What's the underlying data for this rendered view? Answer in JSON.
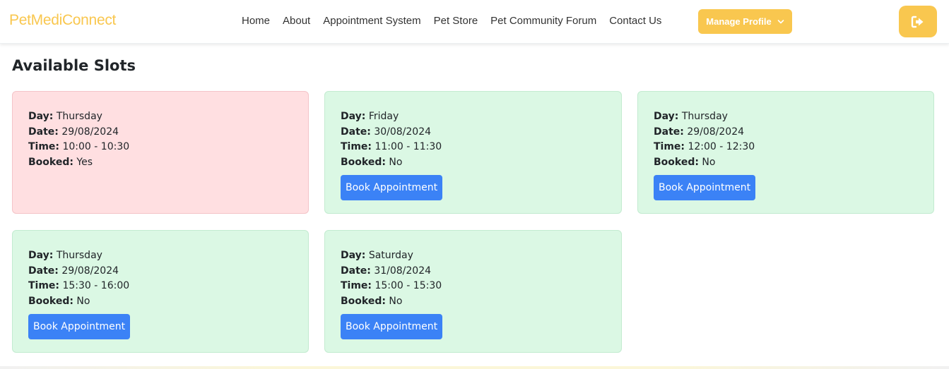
{
  "brand": "PetMediConnect",
  "nav": {
    "links": [
      "Home",
      "About",
      "Appointment System",
      "Pet Store",
      "Pet Community Forum",
      "Contact Us"
    ],
    "manage_profile": "Manage Profile",
    "logout_icon": "sign-out-icon"
  },
  "page": {
    "title": "Available Slots"
  },
  "labels": {
    "day": "Day:",
    "date": "Date:",
    "time": "Time:",
    "booked": "Booked:"
  },
  "slots": [
    {
      "day": "Thursday",
      "date": "29/08/2024",
      "time": "10:00 - 10:30",
      "booked": "Yes",
      "button": ""
    },
    {
      "day": "Friday",
      "date": "30/08/2024",
      "time": "11:00 - 11:30",
      "booked": "No",
      "button": "Book Appointment"
    },
    {
      "day": "Thursday",
      "date": "29/08/2024",
      "time": "12:00 - 12:30",
      "booked": "No",
      "button": "Book Appointment"
    },
    {
      "day": "Thursday",
      "date": "29/08/2024",
      "time": "15:30 - 16:00",
      "booked": "No",
      "button": "Book Appointment"
    },
    {
      "day": "Saturday",
      "date": "31/08/2024",
      "time": "15:00 - 15:30",
      "booked": "No",
      "button": "Book Appointment"
    }
  ],
  "colors": {
    "brand": "#f9c74f",
    "booked_card": "#ffdfe1",
    "free_card": "#dbf8e4",
    "primary_button": "#3b82f6"
  }
}
